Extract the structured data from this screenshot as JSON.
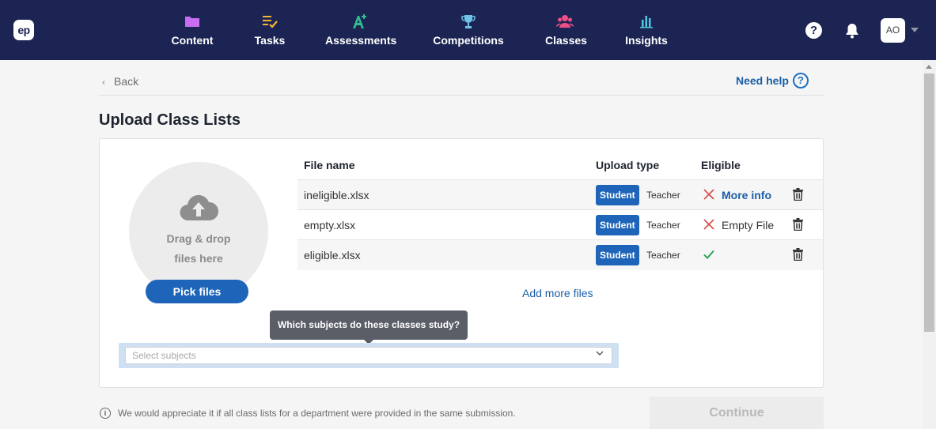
{
  "app": {
    "logo_text": "ep"
  },
  "nav": {
    "items": [
      {
        "label": "Content",
        "icon": "folder-icon",
        "color": "#c86cf2"
      },
      {
        "label": "Tasks",
        "icon": "tasks-icon",
        "color": "#f5b731"
      },
      {
        "label": "Assessments",
        "icon": "assessment-icon",
        "color": "#2fbf8f"
      },
      {
        "label": "Competitions",
        "icon": "trophy-icon",
        "color": "#6fc2e8"
      },
      {
        "label": "Classes",
        "icon": "users-icon",
        "color": "#ef4f85"
      },
      {
        "label": "Insights",
        "icon": "chart-icon",
        "color": "#4fc8e0"
      }
    ],
    "help_glyph": "?",
    "avatar_initials": "AO"
  },
  "header": {
    "back_label": "Back",
    "need_help_label": "Need help",
    "help_glyph": "?",
    "title": "Upload Class Lists"
  },
  "dropzone": {
    "text_line1": "Drag & drop",
    "text_line2": "files here",
    "pick_button_label": "Pick files"
  },
  "table": {
    "columns": [
      "File name",
      "Upload type",
      "Eligible"
    ],
    "rows": [
      {
        "file_name": "ineligible.xlsx",
        "type_selected": "Student",
        "type_other": "Teacher",
        "eligible": false,
        "eligible_text": "More info",
        "eligible_link": true
      },
      {
        "file_name": "empty.xlsx",
        "type_selected": "Student",
        "type_other": "Teacher",
        "eligible": false,
        "eligible_text": "Empty File",
        "eligible_link": false
      },
      {
        "file_name": "eligible.xlsx",
        "type_selected": "Student",
        "type_other": "Teacher",
        "eligible": true,
        "eligible_text": "",
        "eligible_link": false
      }
    ],
    "add_more_label": "Add more files"
  },
  "subjects": {
    "tooltip": "Which subjects do these classes study?",
    "placeholder": "Select subjects"
  },
  "footer": {
    "info_glyph": "i",
    "info_text": "We would appreciate it if all class lists for a department were provided in the same submission.",
    "continue_label": "Continue"
  },
  "colors": {
    "nav_bg": "#1c2453",
    "primary": "#1e65b9",
    "link": "#1a5ea8",
    "error": "#d94a4a",
    "success": "#2ea35a"
  }
}
